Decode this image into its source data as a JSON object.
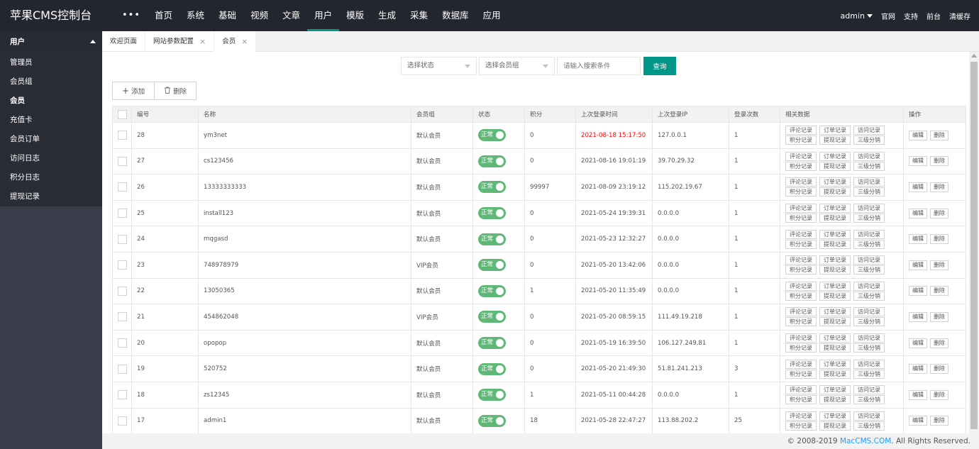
{
  "app": {
    "title": "苹果CMS控制台"
  },
  "topnav": {
    "more": "•••",
    "items": [
      {
        "label": "首页"
      },
      {
        "label": "系统"
      },
      {
        "label": "基础"
      },
      {
        "label": "视频"
      },
      {
        "label": "文章"
      },
      {
        "label": "用户"
      },
      {
        "label": "模版"
      },
      {
        "label": "生成"
      },
      {
        "label": "采集"
      },
      {
        "label": "数据库"
      },
      {
        "label": "应用"
      }
    ],
    "active": "用户"
  },
  "topright": {
    "user": "admin",
    "links": [
      "官网",
      "支持",
      "前台",
      "清缓存"
    ]
  },
  "sidebar": {
    "heading": "用户",
    "items": [
      {
        "label": "管理员"
      },
      {
        "label": "会员组"
      },
      {
        "label": "会员"
      },
      {
        "label": "充值卡"
      },
      {
        "label": "会员订单"
      },
      {
        "label": "访问日志"
      },
      {
        "label": "积分日志"
      },
      {
        "label": "提现记录"
      }
    ],
    "active": "会员"
  },
  "tabs": [
    {
      "label": "欢迎页面",
      "closable": false
    },
    {
      "label": "网站参数配置",
      "closable": true
    },
    {
      "label": "会员",
      "closable": true
    }
  ],
  "search": {
    "status_select": "选择状态",
    "group_select": "选择会员组",
    "input_placeholder": "请输入搜索条件",
    "button": "查询"
  },
  "toolbar": {
    "add": "添加",
    "delete": "删除"
  },
  "table": {
    "headers": [
      "编号",
      "名称",
      "会员组",
      "状态",
      "积分",
      "上次登录时间",
      "上次登录IP",
      "登录次数",
      "相关数据",
      "操作"
    ],
    "related": [
      "评论记录",
      "订单记录",
      "访问记录",
      "积分记录",
      "提现记录",
      "三级分销"
    ],
    "actions": [
      "编辑",
      "删除"
    ],
    "status_label": "正常",
    "rows": [
      {
        "id": "28",
        "name": "ym3net",
        "group": "默认会员",
        "points": "0",
        "time": "2021-08-18 15:17:50",
        "ip": "127.0.0.1",
        "count": "1",
        "highlight": true
      },
      {
        "id": "27",
        "name": "cs123456",
        "group": "默认会员",
        "points": "0",
        "time": "2021-08-16 19:01:19",
        "ip": "39.70.29.32",
        "count": "1"
      },
      {
        "id": "26",
        "name": "13333333333",
        "group": "默认会员",
        "points": "99997",
        "time": "2021-08-09 23:19:12",
        "ip": "115.202.19.67",
        "count": "1"
      },
      {
        "id": "25",
        "name": "install123",
        "group": "默认会员",
        "points": "0",
        "time": "2021-05-24 19:39:31",
        "ip": "0.0.0.0",
        "count": "1"
      },
      {
        "id": "24",
        "name": "mqgasd",
        "group": "默认会员",
        "points": "0",
        "time": "2021-05-23 12:32:27",
        "ip": "0.0.0.0",
        "count": "1"
      },
      {
        "id": "23",
        "name": "748978979",
        "group": "VIP会员",
        "points": "0",
        "time": "2021-05-20 13:42:06",
        "ip": "0.0.0.0",
        "count": "1"
      },
      {
        "id": "22",
        "name": "13050365",
        "group": "默认会员",
        "points": "1",
        "time": "2021-05-20 11:35:49",
        "ip": "0.0.0.0",
        "count": "1"
      },
      {
        "id": "21",
        "name": "454862048",
        "group": "VIP会员",
        "points": "0",
        "time": "2021-05-20 08:59:15",
        "ip": "111.49.19.218",
        "count": "1"
      },
      {
        "id": "20",
        "name": "opopop",
        "group": "默认会员",
        "points": "0",
        "time": "2021-05-19 16:39:50",
        "ip": "106.127.249.81",
        "count": "1"
      },
      {
        "id": "19",
        "name": "520752",
        "group": "默认会员",
        "points": "0",
        "time": "2021-05-20 21:49:30",
        "ip": "51.81.241.213",
        "count": "3"
      },
      {
        "id": "18",
        "name": "zs12345",
        "group": "默认会员",
        "points": "1",
        "time": "2021-05-11 00:44:28",
        "ip": "0.0.0.0",
        "count": "1"
      },
      {
        "id": "17",
        "name": "admin1",
        "group": "默认会员",
        "points": "18",
        "time": "2021-05-28 22:47:27",
        "ip": "113.88.202.2",
        "count": "25"
      }
    ]
  },
  "footer": {
    "prefix": "© 2008-2019",
    "link": "MacCMS.COM",
    "suffix": ". All Rights Reserved."
  },
  "colors": {
    "accent": "#009688",
    "switch_on": "#5fb878",
    "topbar": "#23262e",
    "sidebar": "#393d49",
    "alert_text": "#ff0000"
  }
}
